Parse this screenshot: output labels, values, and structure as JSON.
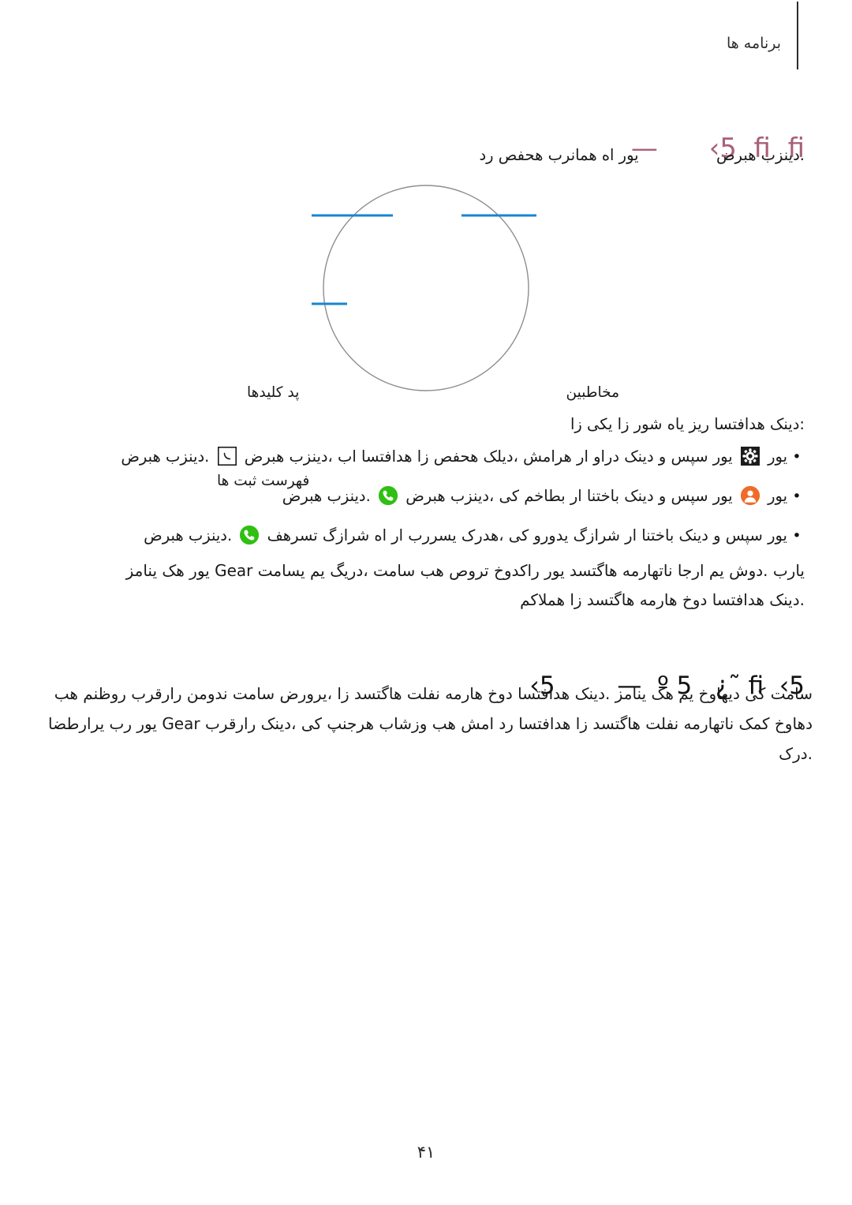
{
  "header": {
    "title": "برنامه ها",
    "rule_color": "#2b2b2b"
  },
  "headings": {
    "h1": "—      ‹5  fi  fi",
    "h1_color": "#a8607a",
    "h2": "‹5        —  º 5   ¿˜ fi  ‹5",
    "h2_color": "#111111"
  },
  "intro": {
    "before_icon": ".دینزب هبرض",
    "after_icon": "یور اه همانرب هحفص رد"
  },
  "methods_lead": ":دینک هدافتسا ریز یاه شور زا یکی زا",
  "bullets": [
    {
      "dot": "•",
      "lead": "یور",
      "icon_left": "keypad-icon",
      "mid": "یور سپس و دینک دراو ار هرامش ،دیلک هحفص زا هدافتسا اب ،دینزب هبرض",
      "icon_right": "call-outline-icon",
      "tail": ".دینزب هبرض"
    },
    {
      "dot": "•",
      "lead": "یور",
      "icon_left": "contact-icon",
      "mid": "یور سپس و دینک باختنا ار بطاخم کی ،دینزب هبرض",
      "icon_right": "call-icon",
      "tail": ".دینزب هبرض"
    },
    {
      "dot": "•",
      "lead": "",
      "icon_left": "",
      "mid": "یور سپس و دینک باختنا ار شرازگ یدورو کی ،هدرک یسررب ار اه شرازگ تسرهف",
      "icon_right": "call-icon",
      "tail": ".دینزب هبرض"
    }
  ],
  "note_paragraph": {
    "line1": "یارب .دوش یم ارجا ناتهارمه هاگتسد یور راکدوخ تروص هب سامت ،دریگ یم یسامت Gear یور هک ینامز",
    "line2": ".دینک هدافتسا دوخ هارمه هاگتسد زا هملاکم"
  },
  "tail_paragraph": {
    "line1": "سامت کی دیهاوخ یم هک ینامز .دینک هدافتسا دوخ هارمه نفلت هاگتسد زا ،یرورض سامت ندومن رارقرب روظنم هب",
    "line2": "دهاوخ کمک ناتهارمه نفلت هاگتسد زا هدافتسا رد امش هب وزشاب هرجنپ کی ،دینک رارقرب Gear یور رب یرارطضا",
    "line3": ".درک"
  },
  "diagram": {
    "circle_color": "#8e8e8e",
    "leader_color": "#1786cf",
    "labels": {
      "contacts": "مخاطبین",
      "keypad": "پد کلیدها",
      "logs": "فهرست ثبت ها"
    }
  },
  "footer": {
    "page_number": "۴۱"
  }
}
